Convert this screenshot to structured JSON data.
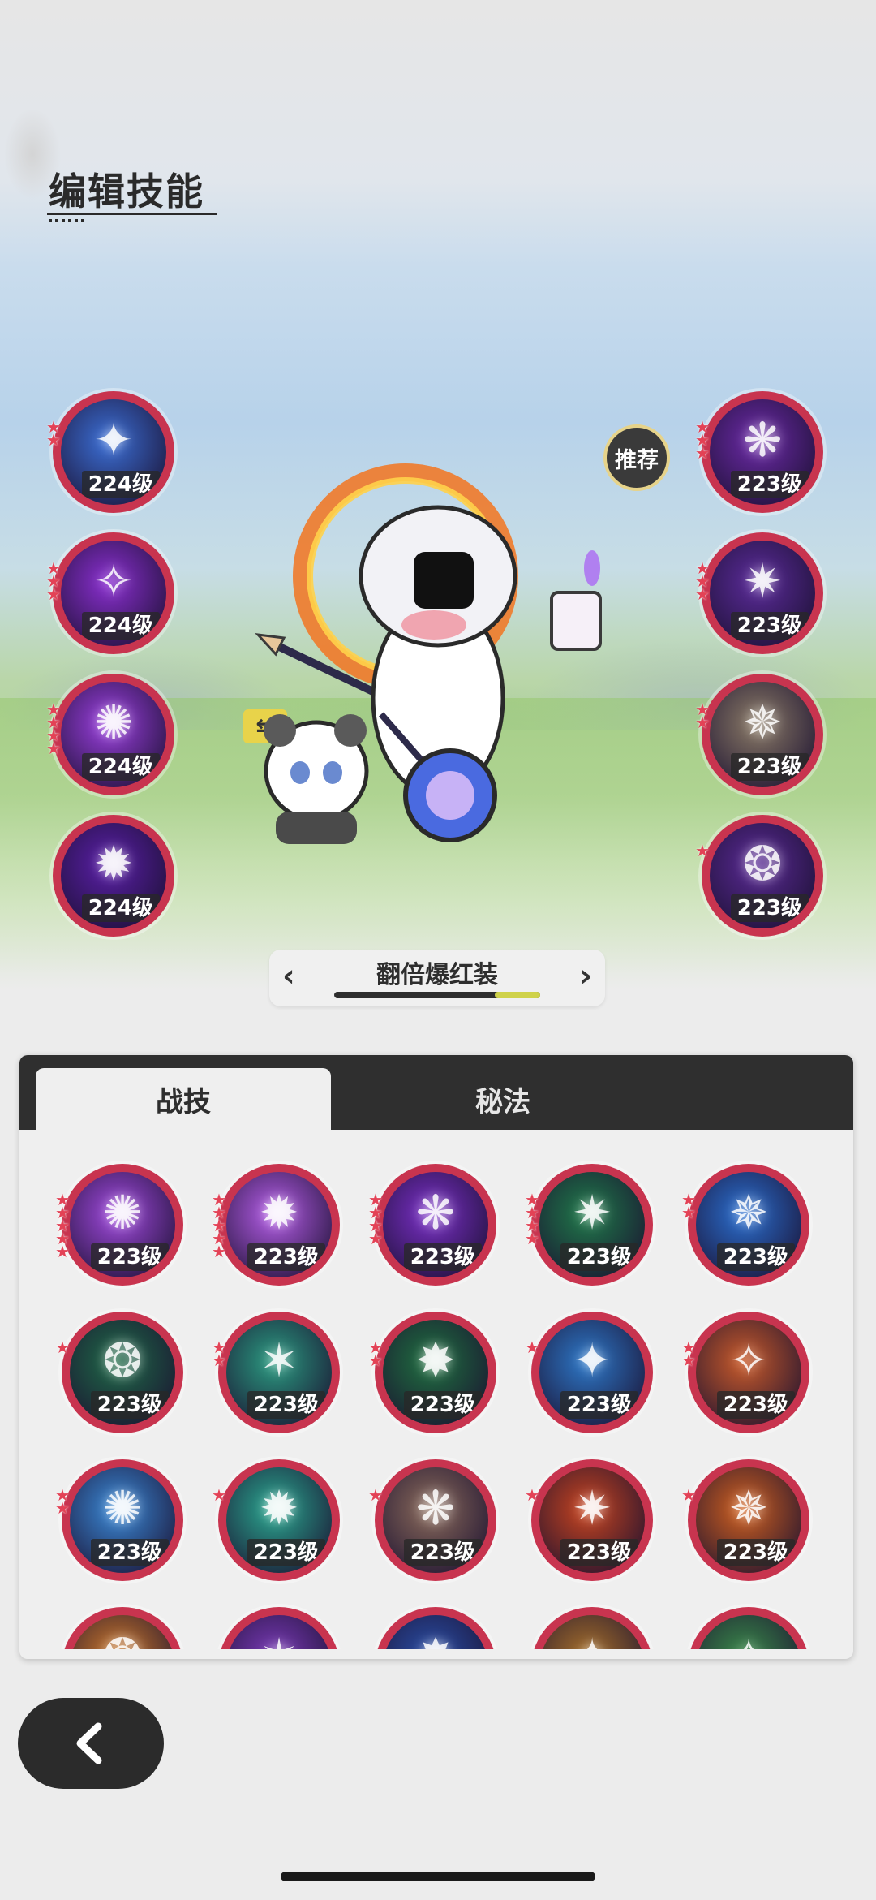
{
  "page_title": "编辑技能",
  "recommend_label": "推荐",
  "preset": {
    "name": "翻倍爆红装",
    "progress": 0.22
  },
  "tabs": [
    {
      "label": "战技",
      "active": true
    },
    {
      "label": "秘法",
      "active": false
    }
  ],
  "equipped_left": [
    {
      "level": "224级",
      "stars": 2,
      "icon": "shield-aura-icon",
      "color": "#3b6fd6"
    },
    {
      "level": "224级",
      "stars": 3,
      "icon": "violet-blade-icon",
      "color": "#8a2fd0"
    },
    {
      "level": "224级",
      "stars": 4,
      "icon": "wing-flame-icon",
      "color": "#9b3fe0"
    },
    {
      "level": "224级",
      "stars": 0,
      "icon": "void-slash-icon",
      "color": "#5a1fa8"
    }
  ],
  "equipped_right": [
    {
      "level": "223级",
      "stars": 3,
      "icon": "crossed-swords-icon",
      "color": "#6c2aa8"
    },
    {
      "level": "223级",
      "stars": 3,
      "icon": "arcane-eye-icon",
      "color": "#5b2b9a"
    },
    {
      "level": "223级",
      "stars": 2,
      "icon": "shadow-figure-icon",
      "color": "#8a7a66"
    },
    {
      "level": "223级",
      "stars": 1,
      "icon": "hooded-mage-icon",
      "color": "#5a2a95"
    }
  ],
  "skills": [
    {
      "level": "223级",
      "stars": 5,
      "icon": "violet-hand-icon",
      "color": "#a24ae0"
    },
    {
      "level": "223级",
      "stars": 5,
      "icon": "violet-burst-icon",
      "color": "#b55de8"
    },
    {
      "level": "223级",
      "stars": 4,
      "icon": "violet-star-icon",
      "color": "#7a2fc8"
    },
    {
      "level": "223级",
      "stars": 4,
      "icon": "green-orbs-icon",
      "color": "#1f7a4a"
    },
    {
      "level": "223级",
      "stars": 2,
      "icon": "blue-flame-icon",
      "color": "#2a6fd0"
    },
    {
      "level": "223级",
      "stars": 1,
      "icon": "thorn-vine-icon",
      "color": "#1f6a48"
    },
    {
      "level": "223级",
      "stars": 2,
      "icon": "green-vortex-icon",
      "color": "#2a9a80"
    },
    {
      "level": "223级",
      "stars": 2,
      "icon": "green-plus-icon",
      "color": "#1f7040"
    },
    {
      "level": "223级",
      "stars": 1,
      "icon": "ice-crystal-icon",
      "color": "#2d78c8"
    },
    {
      "level": "223级",
      "stars": 2,
      "icon": "orange-rune-icon",
      "color": "#c85a2a"
    },
    {
      "level": "223级",
      "stars": 2,
      "icon": "frost-armor-icon",
      "color": "#3a8ad8"
    },
    {
      "level": "223级",
      "stars": 1,
      "icon": "green-leaves-icon",
      "color": "#2aa890"
    },
    {
      "level": "223级",
      "stars": 1,
      "icon": "rune-cards-icon",
      "color": "#8a6a5a"
    },
    {
      "level": "223级",
      "stars": 1,
      "icon": "fire-burst-icon",
      "color": "#c8441f"
    },
    {
      "level": "223级",
      "stars": 1,
      "icon": "fire-swirl-icon",
      "color": "#d0601f"
    },
    {
      "level": "",
      "stars": 0,
      "icon": "orange-orb-icon",
      "color": "#d07a2a"
    },
    {
      "level": "",
      "stars": 0,
      "icon": "violet-sigil-icon",
      "color": "#7a3ab8"
    },
    {
      "level": "",
      "stars": 0,
      "icon": "blue-spike-icon",
      "color": "#2a4fa8"
    },
    {
      "level": "",
      "stars": 0,
      "icon": "golden-plus-icon",
      "color": "#a8702a"
    },
    {
      "level": "",
      "stars": 0,
      "icon": "green-cat-icon",
      "color": "#3a8a4a"
    }
  ]
}
